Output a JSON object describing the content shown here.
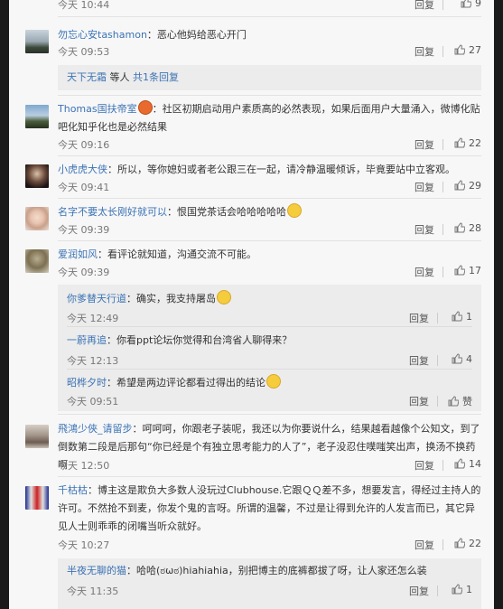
{
  "top_item": {
    "time": "今天 10:44",
    "reply": "回复",
    "likes": "9"
  },
  "comments": [
    {
      "user": "勿忘心安tashamon",
      "text": "：恶心他妈给恶心开门",
      "time": "今天 09:53",
      "reply": "回复",
      "likes": "27",
      "more": {
        "user": "天下无霜",
        "text": " 等人 ",
        "link": "共1条回复"
      }
    },
    {
      "user": "Thomas国扶帝室",
      "text": "：社区初期启动用户素质高的必然表现，如果后面用户大量涌入，微博化贴吧化知乎化也是必然结果",
      "time": "今天 09:16",
      "reply": "回复",
      "likes": "22"
    },
    {
      "user": "小虎虎大侠",
      "text": "：所以，等你媳妇或者老公跟三在一起，请冷静温暖倾诉，毕竟要站中立客观。",
      "time": "今天 09:41",
      "reply": "回复",
      "likes": "29"
    },
    {
      "user": "名字不要太长刚好就可以",
      "text": "：恨国党茶话会哈哈哈哈哈",
      "time": "今天 09:39",
      "reply": "回复",
      "likes": "28"
    },
    {
      "user": "爱润如风",
      "text": "：看评论就知道，沟通交流不可能。",
      "time": "今天 09:39",
      "reply": "回复",
      "likes": "17"
    },
    {
      "user": "飛鴻少俠_请留步",
      "text": "：呵呵呵，你跟老子装呢，我还以为你要说什么，结果越看越像个公知文，到了倒数第二段是后那句“你已经是个有独立思考能力的人了”，老子没忍住噗嗤笑出声，换汤不换药啊",
      "time": "今天 12:50",
      "reply": "回复",
      "likes": "14"
    },
    {
      "user": "千枯枯",
      "text": "：博主这是欺负大多数人没玩过Clubhouse.它跟ＱＱ差不多，想要发言，得经过主持人的许可。不然抢不到麦，你发个鬼的言呀。所谓的温馨，不过是让得到允许的人发言而已，其它异见人士则乖乖的闭嘴当听众就好。",
      "time": "今天 10:27",
      "reply": "回复",
      "likes": "22"
    }
  ],
  "subreplies": [
    {
      "user": "你爹替天行道",
      "text": "：确实，我支持屠岛",
      "time": "今天 12:49",
      "reply": "回复",
      "likes": "1"
    },
    {
      "user": "一蔚再追",
      "text": "：你看ppt论坛你觉得和台湾省人聊得来？",
      "time": "今天 12:13",
      "reply": "回复",
      "likes": "4"
    },
    {
      "user": "昭桦夕时",
      "text": "：希望是两边评论都看过得出的结论",
      "time": "今天 09:51",
      "reply": "回复",
      "likes": "赞"
    },
    {
      "user": "半夜无聊的猫",
      "text": "：哈哈(ಠωಠ)hiahiahia，别把博主的底裤都拔了呀，让人家还怎么装",
      "time": "今天 11:35",
      "reply": "回复",
      "likes": "1"
    }
  ]
}
